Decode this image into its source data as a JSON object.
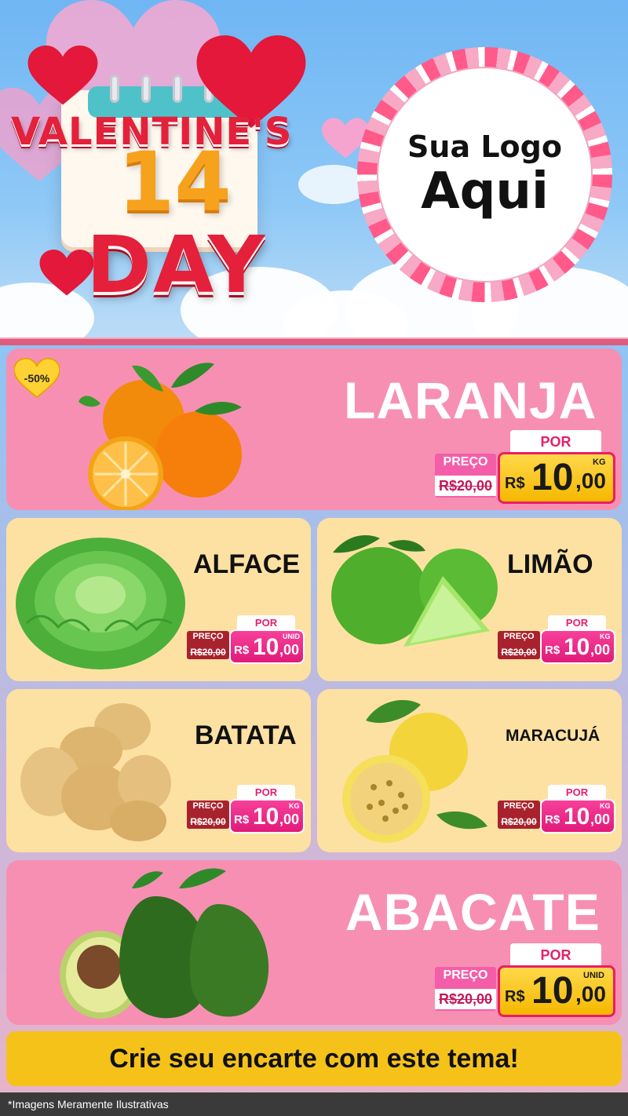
{
  "header": {
    "title_top": "VALENTINE'S",
    "title_number": "14",
    "title_bottom": "DAY",
    "logo_line1": "Sua Logo",
    "logo_line2": "Aqui"
  },
  "badge": {
    "discount": "-50%"
  },
  "products": [
    {
      "name": "LARANJA",
      "preco_label": "PREÇO",
      "old_price": "R$20,00",
      "por_label": "POR",
      "currency": "R$",
      "price_int": "10",
      "price_dec": ",00",
      "unit": "KG",
      "icon": "orange-fruit-image"
    },
    {
      "name": "ALFACE",
      "preco_label": "PREÇO",
      "old_price": "R$20,00",
      "por_label": "POR",
      "currency": "R$",
      "price_int": "10",
      "price_dec": ",00",
      "unit": "UNID",
      "icon": "lettuce-image"
    },
    {
      "name": "LIMÃO",
      "preco_label": "PREÇO",
      "old_price": "R$20,00",
      "por_label": "POR",
      "currency": "R$",
      "price_int": "10",
      "price_dec": ",00",
      "unit": "KG",
      "icon": "lime-image"
    },
    {
      "name": "BATATA",
      "preco_label": "PREÇO",
      "old_price": "R$20,00",
      "por_label": "POR",
      "currency": "R$",
      "price_int": "10",
      "price_dec": ",00",
      "unit": "KG",
      "icon": "potato-image"
    },
    {
      "name": "MARACUJÁ",
      "preco_label": "PREÇO",
      "old_price": "R$20,00",
      "por_label": "POR",
      "currency": "R$",
      "price_int": "10",
      "price_dec": ",00",
      "unit": "KG",
      "icon": "passion-fruit-image"
    },
    {
      "name": "ABACATE",
      "preco_label": "PREÇO",
      "old_price": "R$20,00",
      "por_label": "POR",
      "currency": "R$",
      "price_int": "10",
      "price_dec": ",00",
      "unit": "UNID",
      "icon": "avocado-image"
    }
  ],
  "cta": {
    "text": "Crie seu encarte com este tema!"
  },
  "footer": {
    "text": "*Imagens Meramente Ilustrativas"
  },
  "colors": {
    "pink_card": "#f78fb3",
    "cream_card": "#fde1a3",
    "price_yellow": "#f5b800",
    "price_pink": "#e11a7a",
    "cta_yellow": "#f5c21a",
    "title_red": "#e4203b"
  }
}
